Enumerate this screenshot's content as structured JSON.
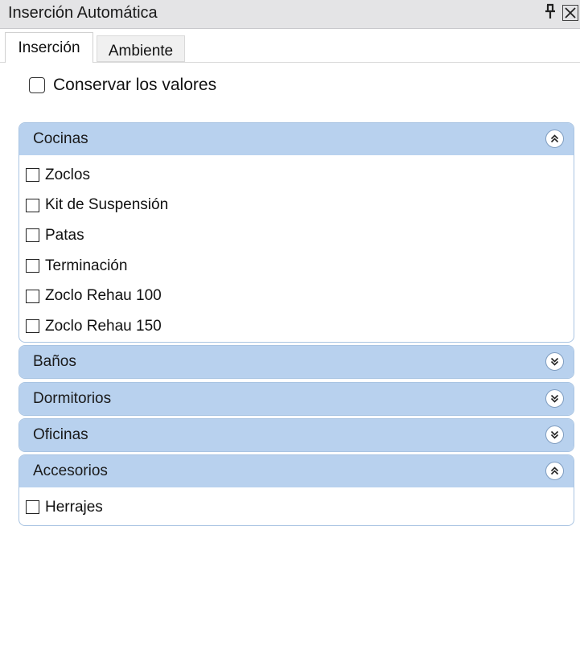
{
  "window": {
    "title": "Inserción Automática",
    "pin_glyph": "ᵽ",
    "close_glyph": "✕"
  },
  "tabs": [
    {
      "label": "Inserción",
      "active": true
    },
    {
      "label": "Ambiente",
      "active": false
    }
  ],
  "keep_values": {
    "label": "Conservar los valores",
    "checked": false
  },
  "groups": [
    {
      "label": "Cocinas",
      "expanded": true,
      "toggle_icon": "chevrons-up-icon",
      "items": [
        {
          "label": "Zoclos"
        },
        {
          "label": "Kit de Suspensión"
        },
        {
          "label": "Patas"
        },
        {
          "label": "Terminación"
        },
        {
          "label": "Zoclo Rehau 100"
        },
        {
          "label": "Zoclo Rehau 150"
        }
      ]
    },
    {
      "label": "Baños",
      "expanded": false,
      "toggle_icon": "chevrons-down-icon",
      "items": []
    },
    {
      "label": "Dormitorios",
      "expanded": false,
      "toggle_icon": "chevrons-down-icon",
      "items": []
    },
    {
      "label": "Oficinas",
      "expanded": false,
      "toggle_icon": "chevrons-down-icon",
      "items": []
    },
    {
      "label": "Accesorios",
      "expanded": true,
      "toggle_icon": "chevrons-up-icon",
      "items": [
        {
          "label": "Herrajes"
        }
      ]
    }
  ],
  "colors": {
    "group_header": "#b8d1ee",
    "group_border": "#a9c4e2",
    "titlebar": "#e4e4e6"
  }
}
